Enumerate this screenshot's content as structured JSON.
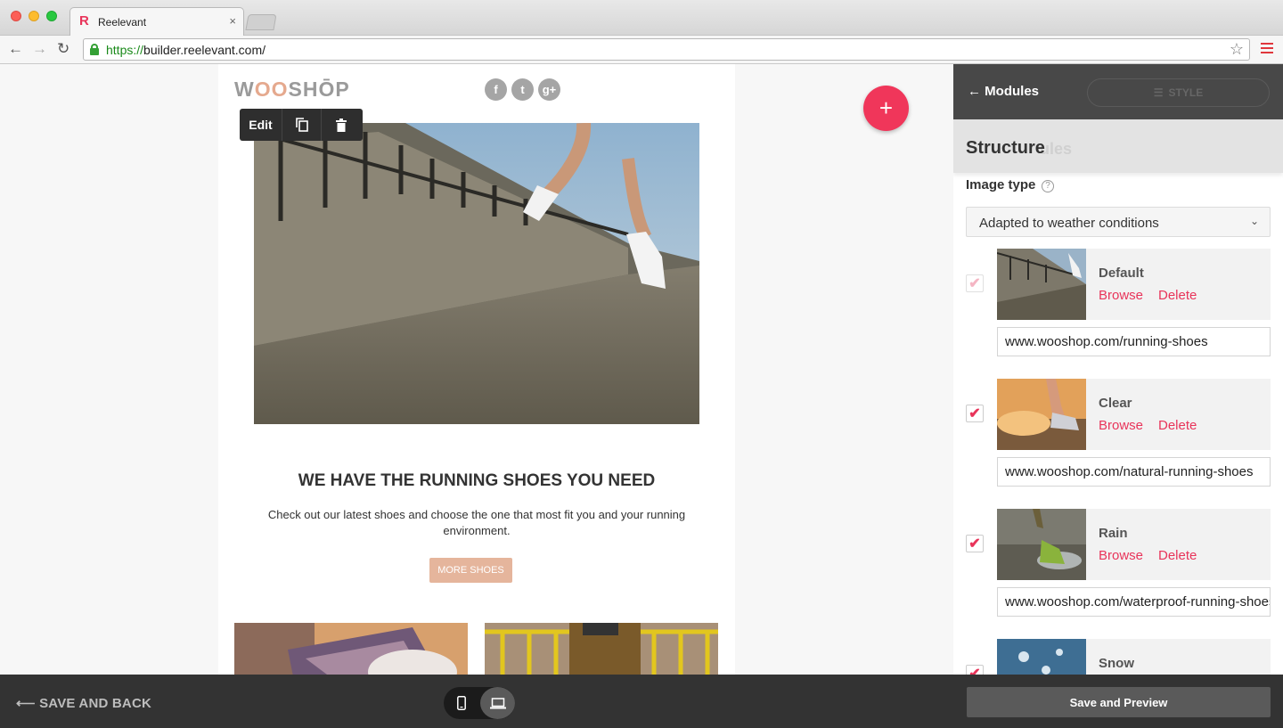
{
  "browser": {
    "tab_title": "Reelevant",
    "tab_close": "×",
    "url_scheme": "https://",
    "url_rest": "builder.reelevant.com/"
  },
  "email": {
    "logo_prefix": "W",
    "logo_oo": "OO",
    "logo_suffix": "SHŌP",
    "social": [
      "f",
      "t",
      "g+"
    ],
    "edit_label": "Edit",
    "headline": "WE HAVE THE RUNNING SHOES YOU NEED",
    "subtext": "Check out our latest shoes and choose the one that most fit you and your running environment.",
    "button": "MORE SHOES"
  },
  "panel": {
    "back_label": "Modules",
    "style_tab": "STYLE",
    "section_title": "Structure",
    "section_ghost": "ules",
    "image_type_label": "Image type",
    "image_type_value": "Adapted to weather conditions",
    "browse_label": "Browse",
    "delete_label": "Delete",
    "items": [
      {
        "name": "Default",
        "checked": true,
        "disabled": true,
        "url": "www.wooshop.com/running-shoes"
      },
      {
        "name": "Clear",
        "checked": true,
        "disabled": false,
        "url": "www.wooshop.com/natural-running-shoes"
      },
      {
        "name": "Rain",
        "checked": true,
        "disabled": false,
        "url": "www.wooshop.com/waterproof-running-shoes"
      },
      {
        "name": "Snow",
        "checked": true,
        "disabled": false,
        "url": ""
      }
    ]
  },
  "bottom": {
    "save_back": "SAVE AND BACK",
    "save_preview": "Save and Preview"
  },
  "colors": {
    "accent": "#e8345a",
    "fab": "#f0365a",
    "panel_header": "#484848",
    "bottom_bar": "#333333",
    "button_peach": "#e5b59c"
  }
}
